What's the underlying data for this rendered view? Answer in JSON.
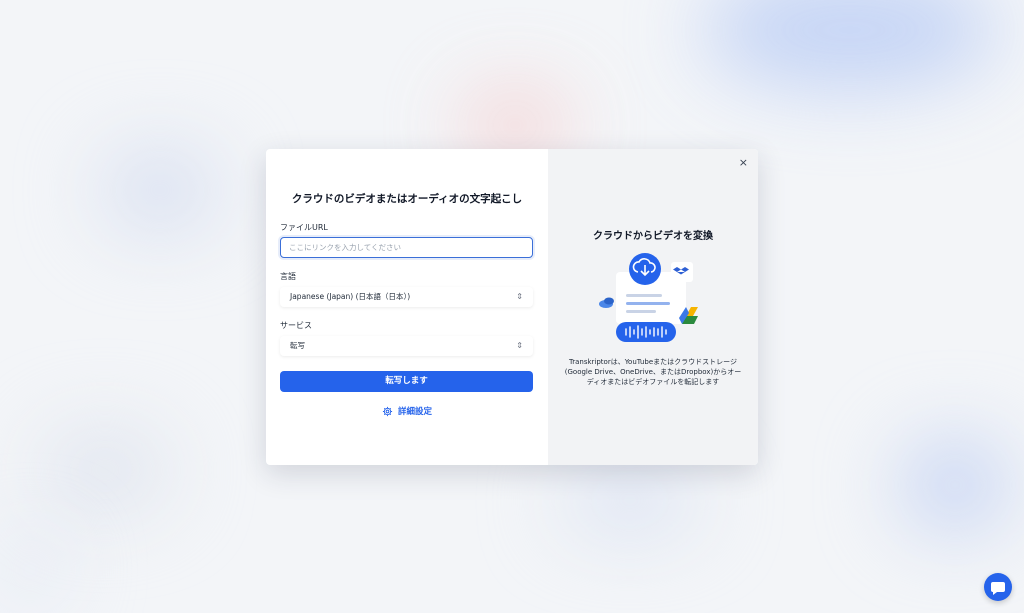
{
  "form": {
    "title": "クラウドのビデオまたはオーディオの文字起こし",
    "file_url_label": "ファイルURL",
    "file_url_placeholder": "ここにリンクを入力してください",
    "language_label": "言語",
    "language_value": "Japanese (Japan) (日本語（日本）)",
    "service_label": "サービス",
    "service_value": "転写",
    "submit_label": "転写します",
    "advanced_label": "詳細設定"
  },
  "info": {
    "title": "クラウドからビデオを変換",
    "description": "Transkriptorは、YouTubeまたはクラウドストレージ(Google Drive、OneDrive、またはDropbox)からオーディオまたはビデオファイルを転記します"
  },
  "icons": {
    "close": "×",
    "caret": "⇕"
  },
  "colors": {
    "accent": "#2563eb"
  }
}
